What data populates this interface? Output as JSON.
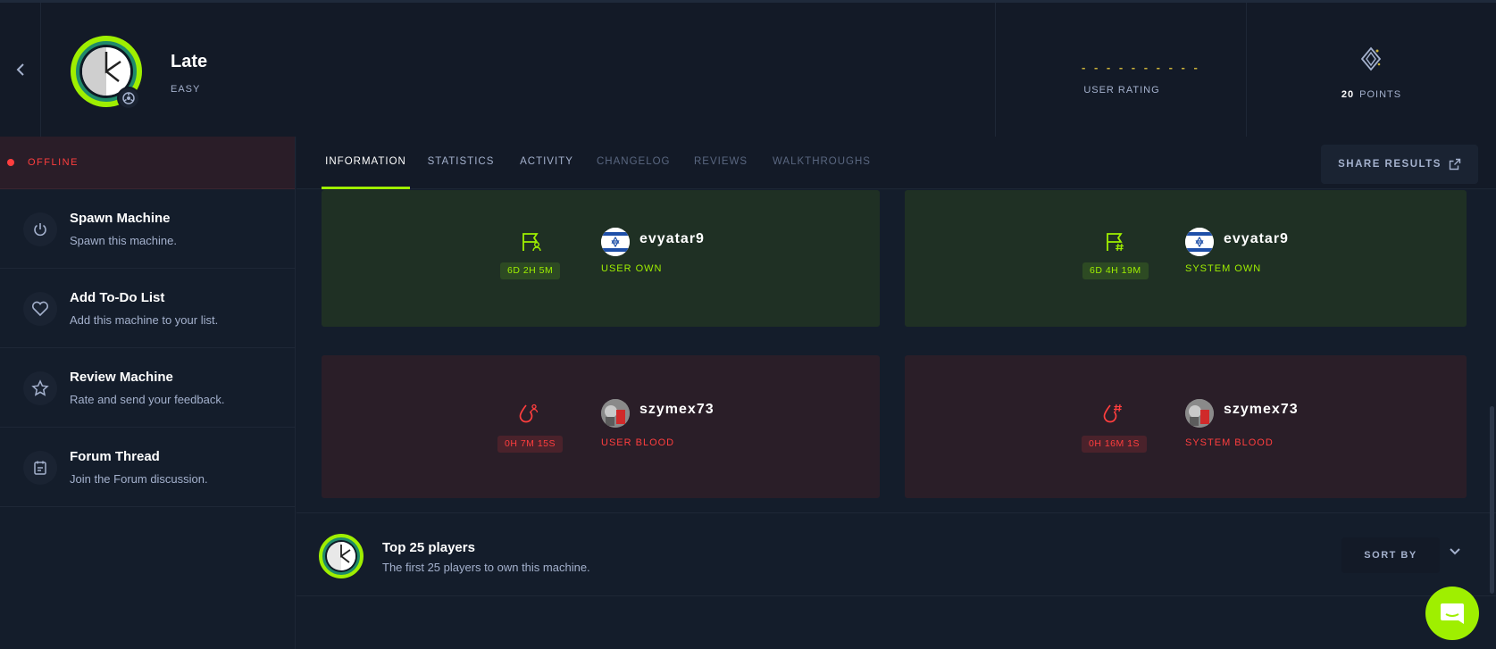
{
  "machine": {
    "name": "Late",
    "difficulty": "EASY",
    "rating_dots": "- - - - - - - - - -",
    "rating_label": "USER RATING",
    "points_value": "20",
    "points_label": "POINTS"
  },
  "status": {
    "label": "OFFLINE",
    "color": "#ff3e3e"
  },
  "sidebar": {
    "items": [
      {
        "title": "Spawn Machine",
        "subtitle": "Spawn this machine.",
        "icon": "power-icon"
      },
      {
        "title": "Add To-Do List",
        "subtitle": "Add this machine to your list.",
        "icon": "heart-icon"
      },
      {
        "title": "Review Machine",
        "subtitle": "Rate and send your feedback.",
        "icon": "star-icon"
      },
      {
        "title": "Forum Thread",
        "subtitle": "Join the Forum discussion.",
        "icon": "forum-icon"
      }
    ]
  },
  "tabs": [
    {
      "label": "INFORMATION",
      "active": true
    },
    {
      "label": "STATISTICS"
    },
    {
      "label": "ACTIVITY"
    },
    {
      "label": "CHANGELOG"
    },
    {
      "label": "REVIEWS"
    },
    {
      "label": "WALKTHROUGHS"
    }
  ],
  "share_label": "SHARE RESULTS",
  "cards": [
    {
      "time": "6D 2H 5M",
      "user": "evyatar9",
      "type": "USER OWN",
      "kind": "own"
    },
    {
      "time": "6D 4H 19M",
      "user": "evyatar9",
      "type": "SYSTEM OWN",
      "kind": "own"
    },
    {
      "time": "0H 7M 15S",
      "user": "szymex73",
      "type": "USER BLOOD",
      "kind": "blood"
    },
    {
      "time": "0H 16M 1S",
      "user": "szymex73",
      "type": "SYSTEM BLOOD",
      "kind": "blood"
    }
  ],
  "top_players": {
    "title": "Top 25 players",
    "subtitle": "The first 25 players to own this machine.",
    "sort_label": "SORT BY"
  },
  "colors": {
    "accent": "#9fef00",
    "danger": "#ff3e3e",
    "background": "#141d2b",
    "panel": "#131a27"
  }
}
